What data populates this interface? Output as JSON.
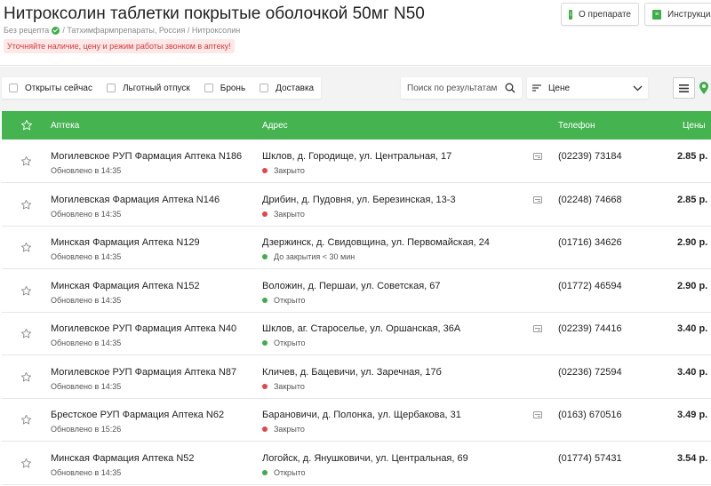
{
  "header": {
    "title": "Нитроксолин таблетки покрытые оболочкой 50мг N50",
    "prescription": "Без рецепта",
    "breadcrumbs": "/ Татхимфармпрепараты, Россия / Нитроксолин",
    "notice": "Уточняйте наличие, цену и режим работы звонком в аптеку!",
    "about_button": "О препарате",
    "instruction_button": "Инструкция"
  },
  "filters": {
    "open_now": "Открыты сейчас",
    "benefit": "Льготный отпуск",
    "booking": "Бронь",
    "delivery": "Доставка",
    "search_placeholder": "Поиск по результатам",
    "sort_label": "Цене"
  },
  "table": {
    "columns": {
      "pharmacy": "Аптека",
      "address": "Адрес",
      "phone": "Телефон",
      "price": "Цены"
    },
    "rows": [
      {
        "name": "Могилевское РУП Фармация Аптека N186",
        "updated": "Обновлено в 14:35",
        "address": "Шклов, д. Городище, ул. Центральная, 17",
        "status": "Закрыто",
        "status_color": "#e0464a",
        "card": true,
        "phone": "(02239) 73184",
        "price": "2.85 р."
      },
      {
        "name": "Могилевская Фармация Аптека N146",
        "updated": "Обновлено в 14:35",
        "address": "Дрибин, д. Пудовня, ул. Березинская, 13-3",
        "status": "Закрыто",
        "status_color": "#e0464a",
        "card": true,
        "phone": "(02248) 74668",
        "price": "2.85 р."
      },
      {
        "name": "Минская Фармация Аптека N129",
        "updated": "Обновлено в 14:35",
        "address": "Дзержинск, д. Свидовщина, ул. Первомайская, 24",
        "status": "До закрытия < 30 мин",
        "status_color": "#3fae4a",
        "card": false,
        "phone": "(01716) 34626",
        "price": "2.90 р."
      },
      {
        "name": "Минская Фармация Аптека N152",
        "updated": "Обновлено в 14:35",
        "address": "Воложин, д. Першаи, ул. Советская, 67",
        "status": "Открыто",
        "status_color": "#3fae4a",
        "card": false,
        "phone": "(01772) 46594",
        "price": "2.90 р."
      },
      {
        "name": "Могилевское РУП Фармация Аптека N40",
        "updated": "Обновлено в 14:35",
        "address": "Шклов, аг. Староселье, ул. Оршанская, 36А",
        "status": "Открыто",
        "status_color": "#3fae4a",
        "card": true,
        "phone": "(02239) 74416",
        "price": "3.40 р."
      },
      {
        "name": "Могилевское РУП Фармация Аптека N87",
        "updated": "Обновлено в 14:35",
        "address": "Кличев, д. Бацевичи, ул. Заречная, 17б",
        "status": "Закрыто",
        "status_color": "#e0464a",
        "card": false,
        "phone": "(02236) 72594",
        "price": "3.40 р."
      },
      {
        "name": "Брестское РУП Фармация Аптека N62",
        "updated": "Обновлено в 15:26",
        "address": "Барановичи, д. Полонка, ул. Щербакова, 31",
        "status": "Закрыто",
        "status_color": "#e0464a",
        "card": true,
        "phone": "(0163) 670516",
        "price": "3.49 р."
      },
      {
        "name": "Минская Фармация Аптека N52",
        "updated": "Обновлено в 14:35",
        "address": "Логойск, д. Янушковичи, ул. Центральная, 69",
        "status": "Открыто",
        "status_color": "#3fae4a",
        "card": false,
        "phone": "(01774) 57431",
        "price": "3.54 р."
      }
    ]
  }
}
